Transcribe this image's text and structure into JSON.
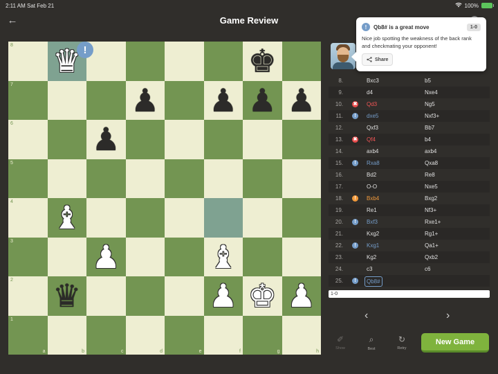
{
  "status": {
    "time": "2:11 AM",
    "date": "Sat Feb 21",
    "battery": "100%",
    "wifi_icon": "wifi-icon"
  },
  "header": {
    "title": "Game Review",
    "back_icon": "←"
  },
  "board": {
    "files": [
      "a",
      "b",
      "c",
      "d",
      "e",
      "f",
      "g",
      "h"
    ],
    "ranks": [
      "8",
      "7",
      "6",
      "5",
      "4",
      "3",
      "2",
      "1"
    ],
    "highlight": [
      "b8",
      "f4"
    ],
    "annotated_square": "b8",
    "annotation": "!",
    "pieces": {
      "b8": {
        "color": "w",
        "glyph": "♛"
      },
      "g8": {
        "color": "b",
        "glyph": "♚"
      },
      "d7": {
        "color": "b",
        "glyph": "♟"
      },
      "f7": {
        "color": "b",
        "glyph": "♟"
      },
      "g7": {
        "color": "b",
        "glyph": "♟"
      },
      "h7": {
        "color": "b",
        "glyph": "♟"
      },
      "c6": {
        "color": "b",
        "glyph": "♟"
      },
      "b4": {
        "color": "w",
        "glyph": "♝"
      },
      "c3": {
        "color": "w",
        "glyph": "♟"
      },
      "f3": {
        "color": "w",
        "glyph": "♝"
      },
      "b2": {
        "color": "b",
        "glyph": "♛"
      },
      "f2": {
        "color": "w",
        "glyph": "♟"
      },
      "g2": {
        "color": "w",
        "glyph": "♚"
      },
      "h2": {
        "color": "w",
        "glyph": "♟"
      }
    }
  },
  "popover": {
    "icon": "!",
    "title": "Qb8# is a great move",
    "score": "1-0",
    "text": "Nice job spotting the weakness of the back rank and checkmating your opponent!",
    "share_label": "Share"
  },
  "moves": [
    {
      "num": "8.",
      "white": "Bxc3",
      "black": "b5"
    },
    {
      "num": "9.",
      "white": "d4",
      "black": "Nxe4"
    },
    {
      "num": "10.",
      "white": "Qd3",
      "black": "Ng5",
      "mark": "blunder"
    },
    {
      "num": "11.",
      "white": "dxe5",
      "black": "Nxf3+",
      "mark": "great"
    },
    {
      "num": "12.",
      "white": "Qxf3",
      "black": "Bb7"
    },
    {
      "num": "13.",
      "white": "Qf4",
      "black": "b4",
      "mark": "blunder"
    },
    {
      "num": "14.",
      "white": "axb4",
      "black": "axb4"
    },
    {
      "num": "15.",
      "white": "Rxa8",
      "black": "Qxa8",
      "mark": "great"
    },
    {
      "num": "16.",
      "white": "Bd2",
      "black": "Re8"
    },
    {
      "num": "17.",
      "white": "O-O",
      "black": "Nxe5"
    },
    {
      "num": "18.",
      "white": "Bxb4",
      "black": "Bxg2",
      "mark": "miss"
    },
    {
      "num": "19.",
      "white": "Re1",
      "black": "Nf3+"
    },
    {
      "num": "20.",
      "white": "Bxf3",
      "black": "Rxe1+",
      "mark": "great"
    },
    {
      "num": "21.",
      "white": "Kxg2",
      "black": "Rg1+"
    },
    {
      "num": "22.",
      "white": "Kxg1",
      "black": "Qa1+",
      "mark": "great"
    },
    {
      "num": "23.",
      "white": "Kg2",
      "black": "Qxb2"
    },
    {
      "num": "24.",
      "white": "c3",
      "black": "c6"
    },
    {
      "num": "25.",
      "white": "Qb8#",
      "black": "",
      "mark": "great",
      "current": true
    }
  ],
  "result": "1-0",
  "nav": {
    "prev": "‹",
    "next": "›"
  },
  "tools": [
    {
      "label": "Show",
      "icon": "✐",
      "name": "show",
      "dim": true
    },
    {
      "label": "Best",
      "icon": "⌕",
      "name": "best",
      "dim": false
    },
    {
      "label": "Retry",
      "icon": "↻",
      "name": "retry",
      "dim": false
    }
  ],
  "new_game_label": "New Game",
  "colors": {
    "board_light": "#eeeed2",
    "board_dark": "#739552",
    "great": "#759dc9",
    "blunder": "#e84c4c",
    "miss": "#f29a3c",
    "accent": "#7fb33d"
  }
}
